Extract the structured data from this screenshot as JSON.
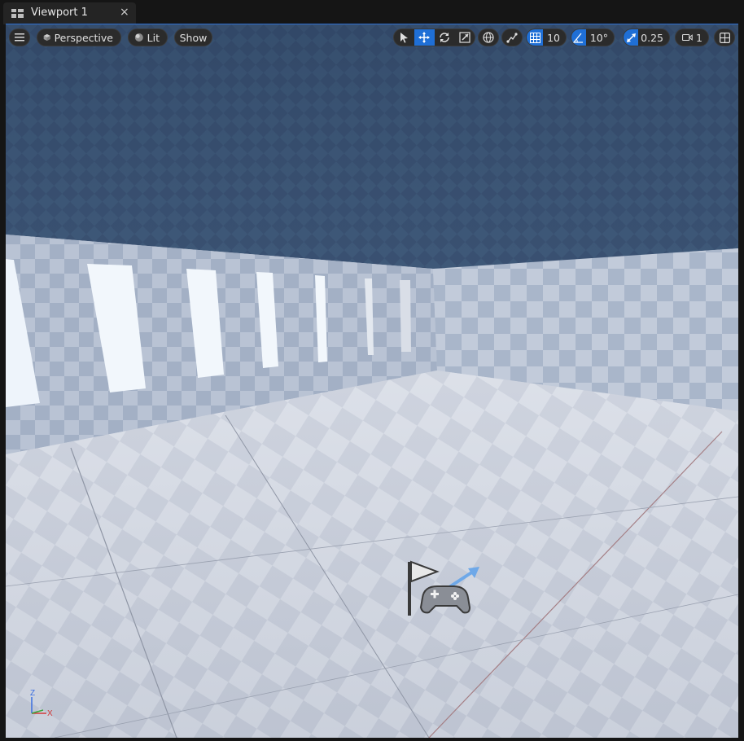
{
  "tab": {
    "title": "Viewport 1",
    "close_glyph": "×",
    "icon": "viewport-grid-icon"
  },
  "toolbar": {
    "menu_icon": "hamburger-menu-icon",
    "view_mode_label": "Perspective",
    "lighting_label": "Lit",
    "show_label": "Show",
    "grid_snap_value": "10",
    "rotation_snap_value": "10°",
    "scale_snap_value": "0.25",
    "camera_speed_value": "1",
    "transform_tools": [
      "select-arrow-icon",
      "translate-move-icon",
      "rotate-icon",
      "scale-icon"
    ],
    "active_transform_tool": "translate-move-icon",
    "accent_color": "#1f6fd6"
  },
  "gizmo": {
    "z_label": "Z",
    "x_label": "X"
  },
  "scene_actor": "player-start-icon"
}
